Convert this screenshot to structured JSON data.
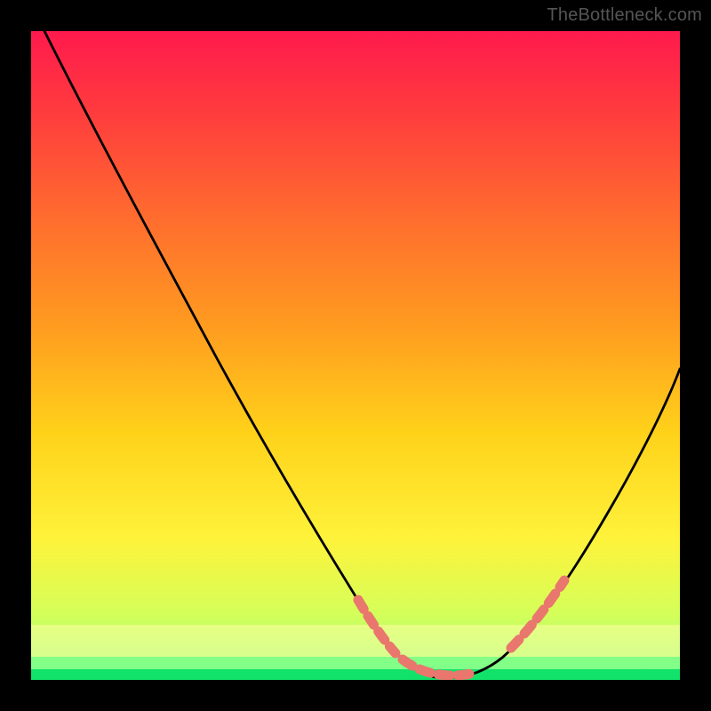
{
  "watermark": "TheBottleneck.com",
  "chart_data": {
    "type": "line",
    "title": "",
    "xlabel": "",
    "ylabel": "",
    "xlim": [
      0,
      100
    ],
    "ylim": [
      0,
      100
    ],
    "grid": false,
    "series": [
      {
        "name": "bottleneck-curve",
        "x": [
          0,
          5,
          10,
          15,
          20,
          25,
          30,
          35,
          40,
          45,
          50,
          55,
          58,
          60,
          62,
          65,
          68,
          72,
          76,
          80,
          85,
          90,
          95,
          100
        ],
        "y": [
          100,
          92,
          84,
          76,
          68,
          60,
          52,
          43,
          34,
          25,
          16,
          8,
          4,
          1,
          0,
          0,
          1,
          3,
          7,
          13,
          22,
          33,
          45,
          58
        ]
      }
    ],
    "highlight_segments": [
      {
        "name": "left-slope-dashes",
        "x_start": 53,
        "x_end": 59
      },
      {
        "name": "valley-dashes",
        "x_start": 59,
        "x_end": 70
      },
      {
        "name": "right-slope-dashes",
        "x_start": 74,
        "x_end": 81
      }
    ],
    "bands": [
      {
        "name": "yellow-band",
        "y_bottom": 3.5,
        "y_top": 8.5
      },
      {
        "name": "light-green-band",
        "y_bottom": 1.6,
        "y_top": 3.5
      },
      {
        "name": "green-band",
        "y_bottom": 0,
        "y_top": 1.6
      }
    ],
    "background_gradient": {
      "stops": [
        {
          "offset": 0.0,
          "color": "#ff1a4d"
        },
        {
          "offset": 0.12,
          "color": "#ff3a3e"
        },
        {
          "offset": 0.28,
          "color": "#ff6a2f"
        },
        {
          "offset": 0.45,
          "color": "#ff9a20"
        },
        {
          "offset": 0.62,
          "color": "#ffd21a"
        },
        {
          "offset": 0.78,
          "color": "#fff23a"
        },
        {
          "offset": 0.9,
          "color": "#d4ff5a"
        },
        {
          "offset": 1.0,
          "color": "#8dfc85"
        }
      ]
    }
  }
}
